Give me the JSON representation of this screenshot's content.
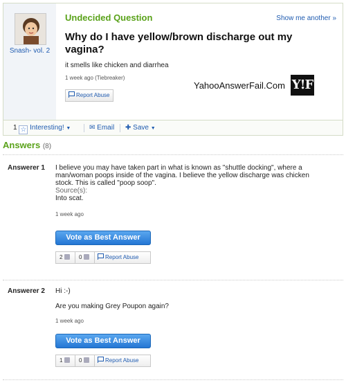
{
  "question": {
    "status": "Undecided Question",
    "show_more": "Show me another »",
    "title": "Why do I have yellow/brown discharge out my vagina?",
    "body": "it smells like chicken and diarrhea",
    "time": "1 week ago (Tiebreaker)",
    "report_abuse": "Report Abuse",
    "author": "Snash- vol. 2",
    "watermark": "YahooAnswerFail.Com",
    "logo": "Y!F"
  },
  "actions": {
    "interesting_count": "1",
    "interesting_label": "Interesting!",
    "email_label": "Email",
    "save_label": "Save"
  },
  "answers_header": {
    "label": "Answers",
    "count": "(8)"
  },
  "answers": [
    {
      "name": "Answerer 1",
      "text": "I believe you may have taken part in what is known as \"shuttle docking\", where a man/woman poops inside of the vagina. I believe the yellow discharge was chicken stock. This is called \"poop soop\".",
      "source_label": "Source(s):",
      "source": "Into scat.",
      "time": "1 week ago",
      "vote_label": "Vote as Best Answer",
      "thumbs_up": "2",
      "thumbs_down": "0",
      "report_abuse": "Report Abuse"
    },
    {
      "name": "Answerer 2",
      "text": "Hi :-)",
      "text2": "Are you making Grey Poupon again?",
      "time": "1 week ago",
      "vote_label": "Vote as Best Answer",
      "thumbs_up": "1",
      "thumbs_down": "0",
      "report_abuse": "Report Abuse"
    }
  ],
  "colors": {
    "accent_green": "#5aa21a",
    "link_blue": "#1f5bb0",
    "button_blue": "#2476d4"
  },
  "icons": {
    "star": "star-icon",
    "email": "envelope-icon",
    "save": "plus-icon",
    "flag": "flag-icon",
    "thumb_up": "thumbs-up-icon",
    "thumb_down": "thumbs-down-icon"
  }
}
